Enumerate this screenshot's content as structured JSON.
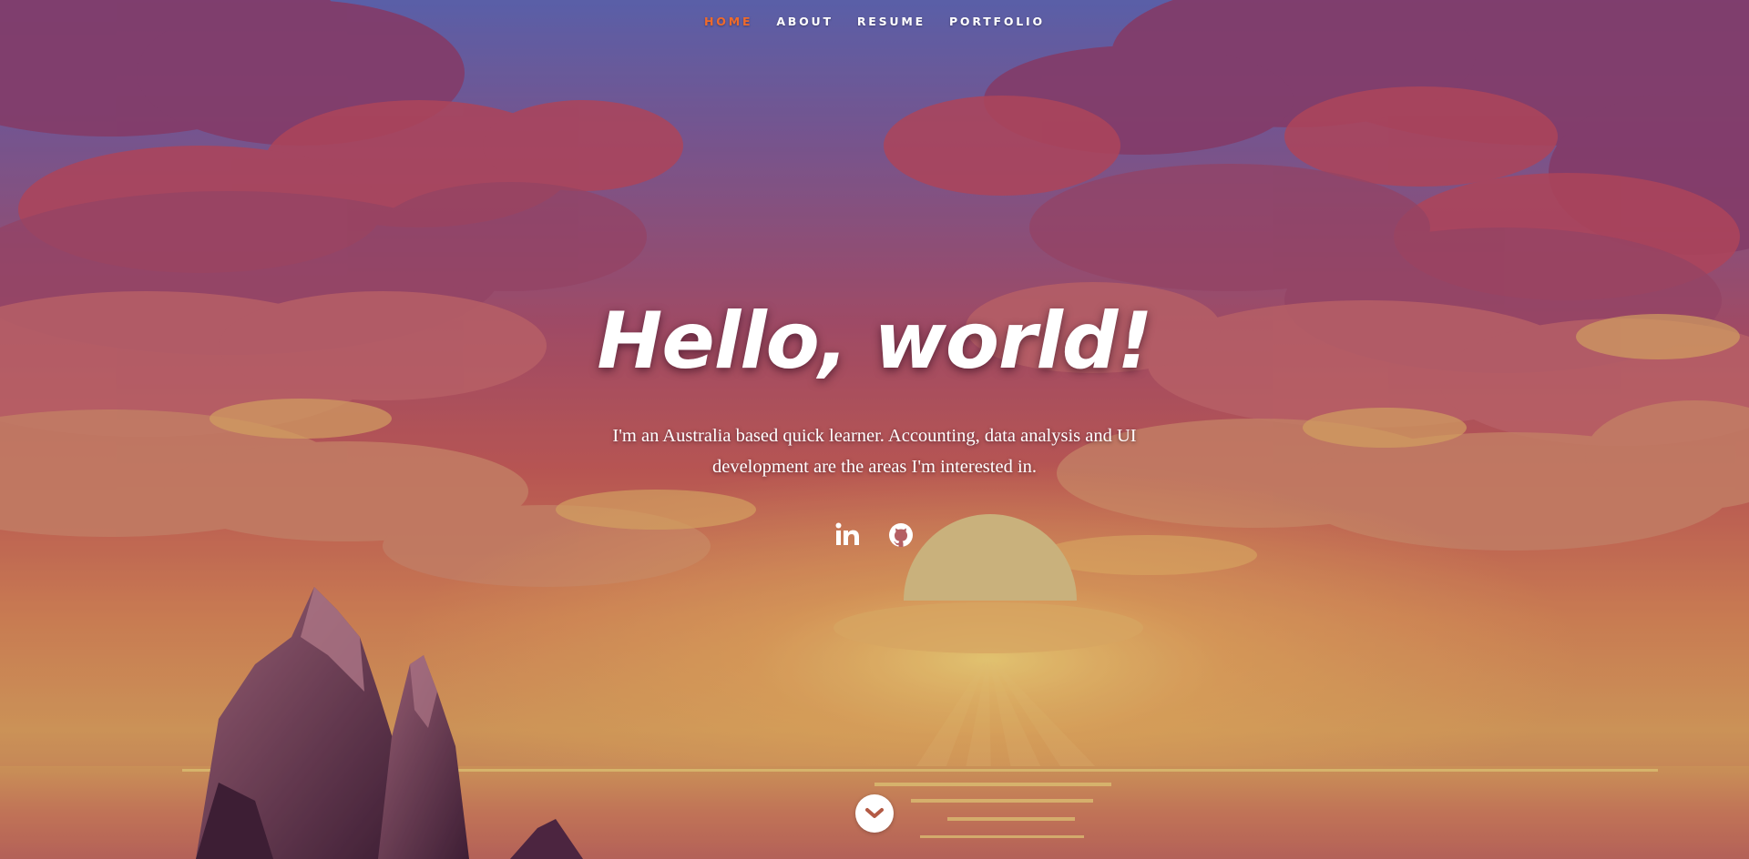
{
  "nav": {
    "items": [
      {
        "label": "HOME",
        "current": true
      },
      {
        "label": "ABOUT",
        "current": false
      },
      {
        "label": "RESUME",
        "current": false
      },
      {
        "label": "PORTFOLIO",
        "current": false
      }
    ]
  },
  "banner": {
    "headline": "Hello, world!",
    "intro": "I'm an Australia based quick learner. Accounting, data analysis and UI development are the areas I'm interested in."
  },
  "social": {
    "links": [
      {
        "icon": "linkedin-icon"
      },
      {
        "icon": "github-icon"
      }
    ]
  },
  "scroll": {
    "icon": "chevron-down-icon"
  },
  "colors": {
    "accent": "#f06a2a",
    "text": "#ffffff",
    "sky_top": "#5a6ab8",
    "sky_mid": "#b04f62",
    "horizon": "#e0a85a",
    "sun": "#d8c27e"
  }
}
